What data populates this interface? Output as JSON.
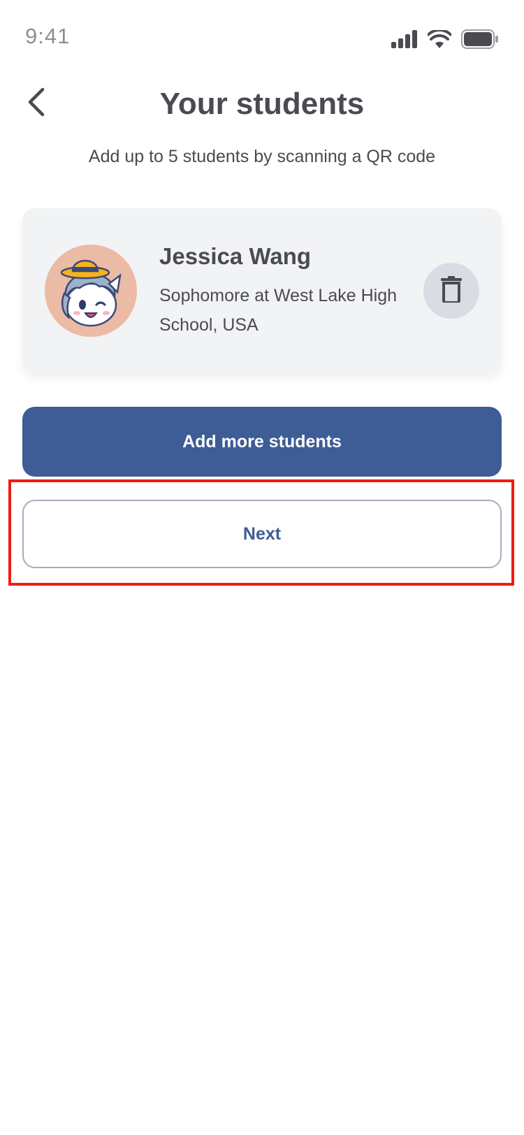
{
  "status_bar": {
    "time": "9:41",
    "icons": [
      "cellular-signal-icon",
      "wifi-icon",
      "battery-icon"
    ]
  },
  "header": {
    "back_icon": "chevron-left-icon",
    "title": "Your students"
  },
  "subtitle": "Add up to 5 students by scanning a QR code",
  "students": [
    {
      "name": "Jessica Wang",
      "description": "Sophomore at West Lake High School, USA",
      "avatar_icon": "unicorn-avatar-icon",
      "action_icon": "trash-icon"
    }
  ],
  "buttons": {
    "add_more": "Add more students",
    "next": "Next"
  },
  "colors": {
    "primary": "#3e5c95",
    "text": "#4a4b51",
    "card": "#f2f3f5",
    "avatar_bg": "#ebbba5",
    "highlight": "#ee1c10"
  }
}
